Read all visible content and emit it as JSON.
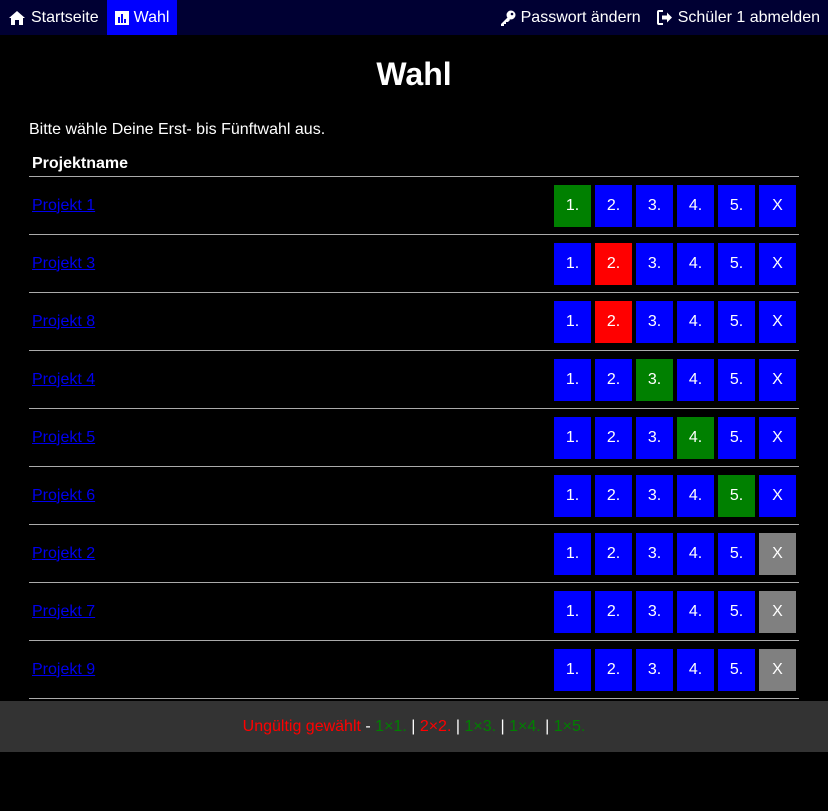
{
  "nav": {
    "home_label": "Startseite",
    "wahl_label": "Wahl",
    "password_label": "Passwort ändern",
    "logout_label": "Schüler 1 abmelden"
  },
  "page": {
    "title": "Wahl",
    "intro": "Bitte wähle Deine Erst- bis Fünftwahl aus.",
    "column_header": "Projektname"
  },
  "colors": {
    "default": "#0000ff",
    "selected_valid": "#008000",
    "selected_invalid": "#ff0000",
    "not_selected_x": "#808080",
    "nav_bg": "#000033",
    "footer_bg": "#333333"
  },
  "option_labels": [
    "1.",
    "2.",
    "3.",
    "4.",
    "5.",
    "X"
  ],
  "projects": [
    {
      "name": "Projekt 1",
      "state": [
        "green",
        "blue",
        "blue",
        "blue",
        "blue",
        "blue"
      ]
    },
    {
      "name": "Projekt 3",
      "state": [
        "blue",
        "red",
        "blue",
        "blue",
        "blue",
        "blue"
      ]
    },
    {
      "name": "Projekt 8",
      "state": [
        "blue",
        "red",
        "blue",
        "blue",
        "blue",
        "blue"
      ]
    },
    {
      "name": "Projekt 4",
      "state": [
        "blue",
        "blue",
        "green",
        "blue",
        "blue",
        "blue"
      ]
    },
    {
      "name": "Projekt 5",
      "state": [
        "blue",
        "blue",
        "blue",
        "green",
        "blue",
        "blue"
      ]
    },
    {
      "name": "Projekt 6",
      "state": [
        "blue",
        "blue",
        "blue",
        "blue",
        "green",
        "blue"
      ]
    },
    {
      "name": "Projekt 2",
      "state": [
        "blue",
        "blue",
        "blue",
        "blue",
        "blue",
        "grey"
      ]
    },
    {
      "name": "Projekt 7",
      "state": [
        "blue",
        "blue",
        "blue",
        "blue",
        "blue",
        "grey"
      ]
    },
    {
      "name": "Projekt 9",
      "state": [
        "blue",
        "blue",
        "blue",
        "blue",
        "blue",
        "grey"
      ]
    }
  ],
  "footer": {
    "status": "Ungültig gewählt",
    "sep_dash": " - ",
    "counts": [
      {
        "text": "1×1.",
        "color": "green"
      },
      {
        "text": "2×2.",
        "color": "red"
      },
      {
        "text": "1×3.",
        "color": "green"
      },
      {
        "text": "1×4.",
        "color": "green"
      },
      {
        "text": "1×5.",
        "color": "green"
      }
    ],
    "sep": " | "
  }
}
